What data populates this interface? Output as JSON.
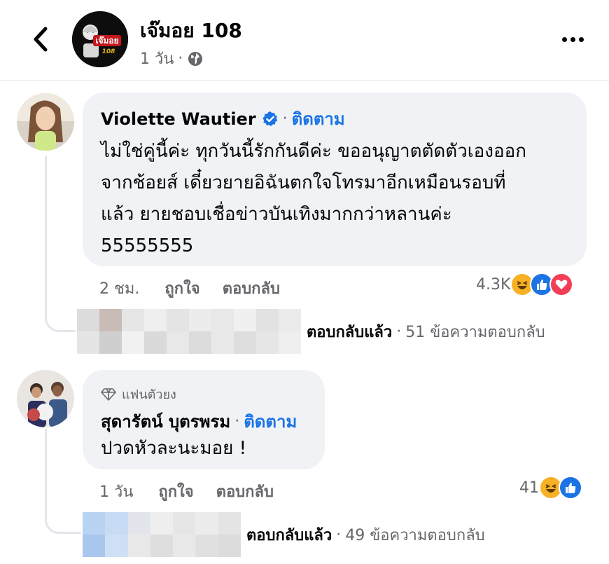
{
  "header": {
    "page_name": "เจ๊มอย 108",
    "time": "1 วัน",
    "separator": "·",
    "avatar_text": "เจ๊มอย",
    "avatar_sub": "108"
  },
  "comments": [
    {
      "author": "Violette Wautier",
      "verified": true,
      "separator": "·",
      "follow_label": "ติดตาม",
      "lines": [
        "ไม่ใช่คู่นี้ค่ะ ทุกวันนี้รักกันดีค่ะ ขออนุญาตตัดตัวเองออก",
        "จากช้อยส์ เดี๋ยวยายอิฉันตกใจโทรมาอีกเหมือนรอบที่",
        "แล้ว ยายชอบเชื่อข่าวบันเทิงมากกว่าหลานค่ะ",
        "55555555"
      ],
      "time": "2 ชม.",
      "like_label": "ถูกใจ",
      "reply_label": "ตอบกลับ",
      "reaction_count": "4.3K",
      "reactions": [
        "haha-icon",
        "like-icon",
        "love-icon"
      ],
      "replies_label": "ตอบกลับแล้ว",
      "replies_sep": "·",
      "replies_count": "51 ข้อความตอบกลับ"
    },
    {
      "badge": "แฟนตัวยง",
      "author": "สุดารัตน์ บุตรพรม",
      "separator": "·",
      "follow_label": "ติดตาม",
      "lines": [
        "ปวดหัวละนะมอย !"
      ],
      "time": "1 วัน",
      "like_label": "ถูกใจ",
      "reply_label": "ตอบกลับ",
      "reaction_count": "41",
      "reactions": [
        "haha-icon",
        "like-icon"
      ],
      "replies_label": "ตอบกลับแล้ว",
      "replies_sep": "·",
      "replies_count": "49 ข้อความตอบกลับ"
    }
  ],
  "colors": {
    "accent": "#1b74e4",
    "bubble": "#f0f2f5",
    "secondary_text": "#65676b",
    "love": "#f33e58",
    "haha": "#f7b125"
  }
}
